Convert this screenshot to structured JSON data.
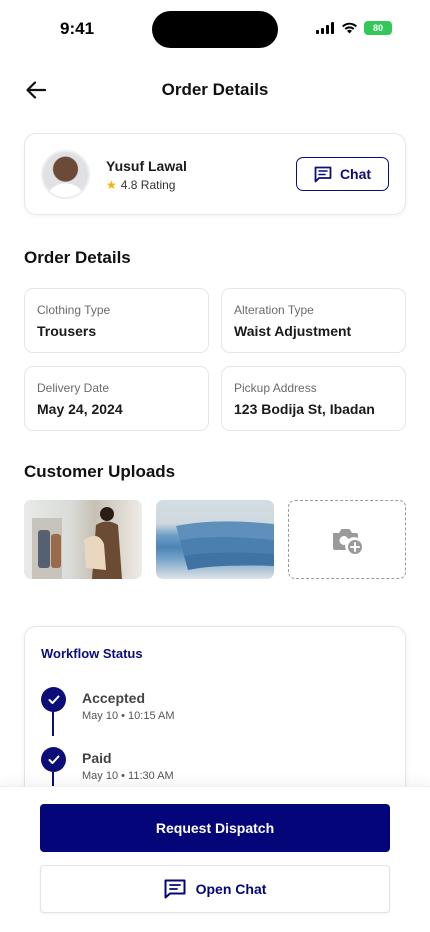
{
  "status_bar": {
    "time": "9:41",
    "battery": "80"
  },
  "header": {
    "title": "Order Details",
    "back_icon": "arrow-left-icon"
  },
  "tailor": {
    "name": "Yusuf Lawal",
    "rating": "4.8 Rating",
    "chat_label": "Chat"
  },
  "order_details": {
    "section_title": "Order Details",
    "items": [
      {
        "label": "Clothing Type",
        "value": "Trousers"
      },
      {
        "label": "Alteration Type",
        "value": "Waist Adjustment"
      },
      {
        "label": "Delivery Date",
        "value": "May 24, 2024"
      },
      {
        "label": "Pickup Address",
        "value": "123 Bodija St, Ibadan"
      }
    ]
  },
  "uploads": {
    "section_title": "Customer Uploads",
    "add_icon": "add-photo-icon"
  },
  "workflow": {
    "title": "Workflow Status",
    "steps": [
      {
        "title": "Accepted",
        "time": "May 10 • 10:15 AM"
      },
      {
        "title": "Paid",
        "time": "May 10 • 11:30 AM"
      }
    ]
  },
  "actions": {
    "primary_label": "Request Dispatch",
    "secondary_label": "Open Chat"
  },
  "colors": {
    "brand": "#05057a",
    "rating_star": "#f4b400",
    "battery": "#34c759"
  }
}
